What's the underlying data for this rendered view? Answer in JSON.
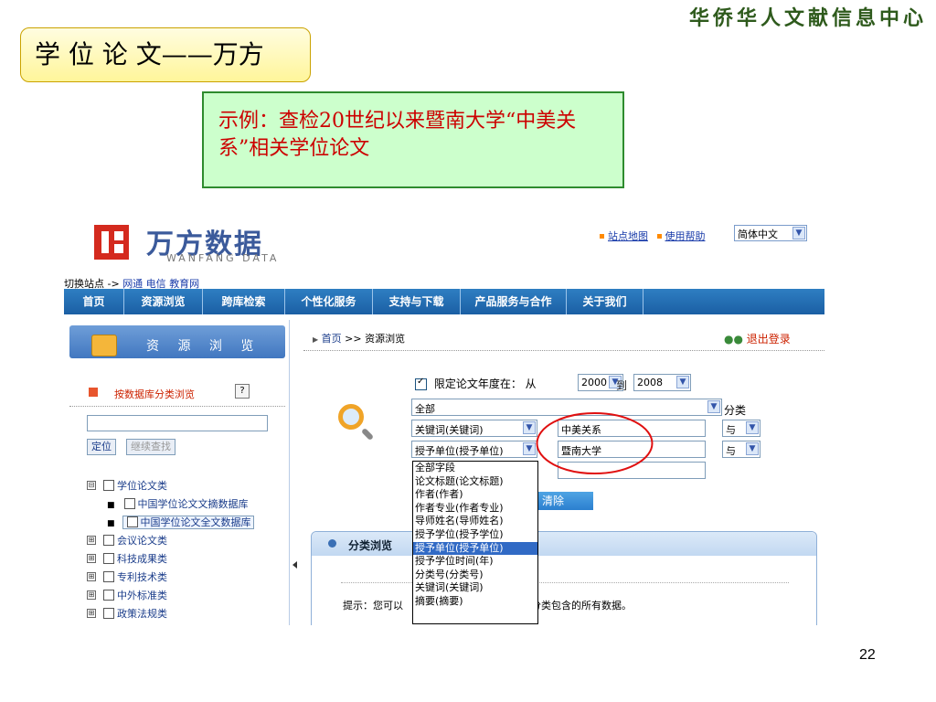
{
  "slide": {
    "banner": "华侨华人文献信息中心",
    "title": "学 位 论 文——万方",
    "example": "示例：查检20世纪以来暨南大学“中美关系”相关学位论文",
    "page_number": "22"
  },
  "site": {
    "logo_cn": "万方数据",
    "logo_en": "WANFANG DATA",
    "switch_label": "切换站点 ->",
    "switch_links": [
      "网通",
      "电信",
      "教育网"
    ],
    "top_links": [
      "站点地图",
      "使用帮助"
    ],
    "language": "简体中文",
    "nav": [
      "首页",
      "资源浏览",
      "跨库检索",
      "个性化服务",
      "支持与下载",
      "产品服务与合作",
      "关于我们"
    ]
  },
  "left": {
    "header": "资 源 浏 览",
    "category_link": "按数据库分类浏览",
    "help": "?",
    "locate_button": "定位",
    "continue_button": "继续查找",
    "tree": [
      {
        "label": "学位论文类",
        "expander": "⊟"
      },
      {
        "label": "中国学位论文文摘数据库",
        "bullet": "■"
      },
      {
        "label": "中国学位论文全文数据库",
        "bullet": "■"
      },
      {
        "label": "会议论文类",
        "expander": "⊞"
      },
      {
        "label": "科技成果类",
        "expander": "⊞"
      },
      {
        "label": "专利技术类",
        "expander": "⊞"
      },
      {
        "label": "中外标准类",
        "expander": "⊞"
      },
      {
        "label": "政策法规类",
        "expander": "⊞"
      }
    ]
  },
  "main": {
    "breadcrumb_home": "首页",
    "breadcrumb_sep": ">>",
    "breadcrumb_current": "资源浏览",
    "logout": "退出登录",
    "year_label": "限定论文年度在：",
    "from_label": "从",
    "from_year": "2000",
    "to_label": "到",
    "to_year": "2008",
    "category_select": "全部",
    "category_label": "分类",
    "field1": "关键词(关键词)",
    "value1": "中美关系",
    "logic1": "与",
    "field2": "授予单位(授予单位)",
    "value2": "暨南大学",
    "logic2": "与",
    "dropdown_options": [
      "全部字段",
      "论文标题(论文标题)",
      "作者(作者)",
      "作者专业(作者专业)",
      "导师姓名(导师姓名)",
      "授予学位(授予学位)",
      "授予单位(授予单位)",
      "授予学位时间(年)",
      "分类号(分类号)",
      "关键词(关键词)",
      "摘要(摘要)"
    ],
    "dropdown_selected_index": 6,
    "clear_button": "清除",
    "classify_title": "分类浏览",
    "hint_prefix": "提示：您可以",
    "hint_suffix": "分类包含的所有数据。"
  }
}
